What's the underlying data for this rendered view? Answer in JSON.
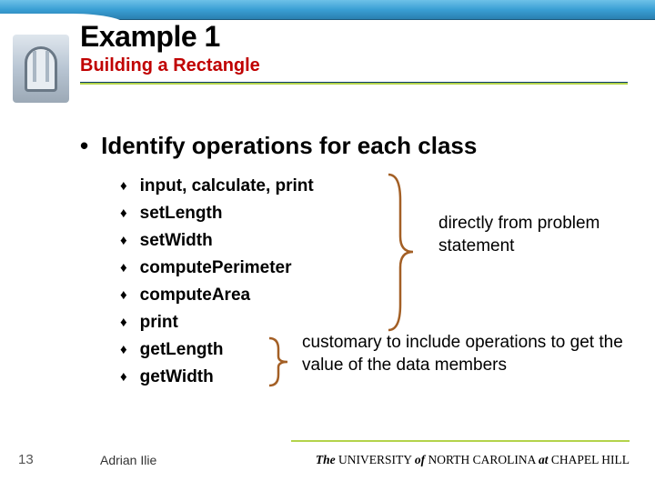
{
  "header": {
    "title": "Example 1",
    "subtitle": "Building a Rectangle"
  },
  "main": {
    "bullet": "Identify operations for each class",
    "items": [
      "input, calculate, print",
      "setLength",
      "setWidth",
      "computePerimeter",
      "computeArea",
      "print",
      "getLength",
      "getWidth"
    ],
    "annotation1": "directly from problem statement",
    "annotation2": "customary to include operations to get the value of the data members"
  },
  "footer": {
    "slidenum": "13",
    "author": "Adrian Ilie",
    "uni_the": "The",
    "uni_name": " UNIVERSITY ",
    "uni_of": "of",
    "uni_nc": " NORTH CAROLINA ",
    "uni_at": "at",
    "uni_ch": " CHAPEL HILL"
  }
}
